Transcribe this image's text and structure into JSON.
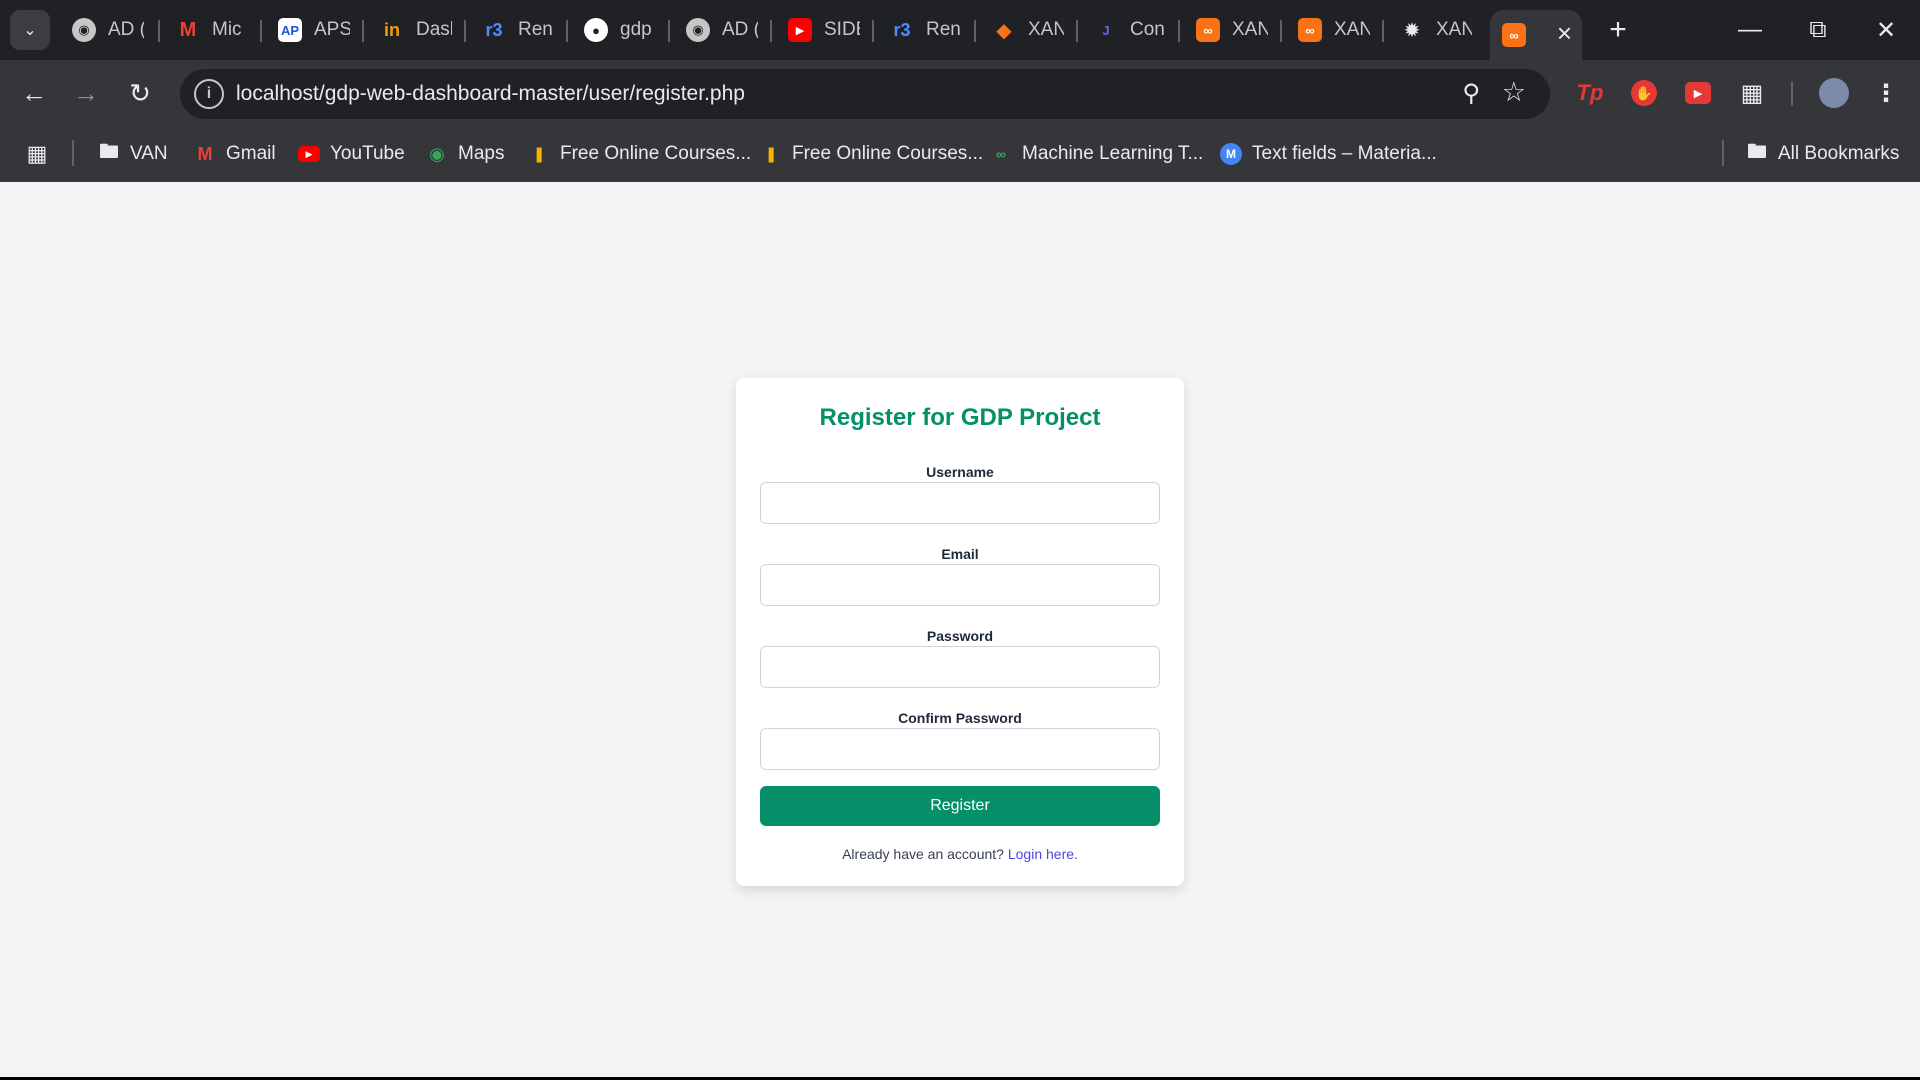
{
  "browser": {
    "tabs": [
      {
        "title": "AD (",
        "icon": "globe-icon"
      },
      {
        "title": "Mic",
        "icon": "gmail-icon"
      },
      {
        "title": "APS",
        "icon": "aps-icon"
      },
      {
        "title": "Dasl",
        "icon": "dashboard-icon"
      },
      {
        "title": "Ren",
        "icon": "render-icon"
      },
      {
        "title": "gdp",
        "icon": "github-icon"
      },
      {
        "title": "AD (",
        "icon": "globe-icon"
      },
      {
        "title": "SIDE",
        "icon": "youtube-icon"
      },
      {
        "title": "Ren",
        "icon": "render-icon"
      },
      {
        "title": "XAN",
        "icon": "xampp-diamond-icon"
      },
      {
        "title": "Con",
        "icon": "jira-icon"
      },
      {
        "title": "XAN",
        "icon": "xampp-icon"
      },
      {
        "title": "XAN",
        "icon": "xampp-icon"
      },
      {
        "title": "XAN",
        "icon": "openai-icon"
      }
    ],
    "active_tab_icon": "xampp-icon",
    "url": "localhost/gdp-web-dashboard-master/user/register.php",
    "bookmarks": [
      {
        "label": "VAN",
        "icon": "folder-icon"
      },
      {
        "label": "Gmail",
        "icon": "gmail-icon"
      },
      {
        "label": "YouTube",
        "icon": "youtube-icon"
      },
      {
        "label": "Maps",
        "icon": "maps-icon"
      },
      {
        "label": "Free Online Courses...",
        "icon": "courses-icon"
      },
      {
        "label": "Free Online Courses...",
        "icon": "courses-icon"
      },
      {
        "label": "Machine Learning T...",
        "icon": "ml-icon"
      },
      {
        "label": "Text fields – Materia...",
        "icon": "material-icon"
      }
    ],
    "all_bookmarks_label": "All Bookmarks"
  },
  "register_form": {
    "title": "Register for GDP Project",
    "username_label": "Username",
    "email_label": "Email",
    "password_label": "Password",
    "confirm_password_label": "Confirm Password",
    "username_value": "",
    "email_value": "",
    "password_value": "",
    "confirm_password_value": "",
    "submit_label": "Register",
    "footer_text": "Already have an account?",
    "login_link": "Login here."
  },
  "colors": {
    "accent": "#06906a",
    "link": "#4f46e5",
    "page_bg": "#f3f4f6"
  }
}
